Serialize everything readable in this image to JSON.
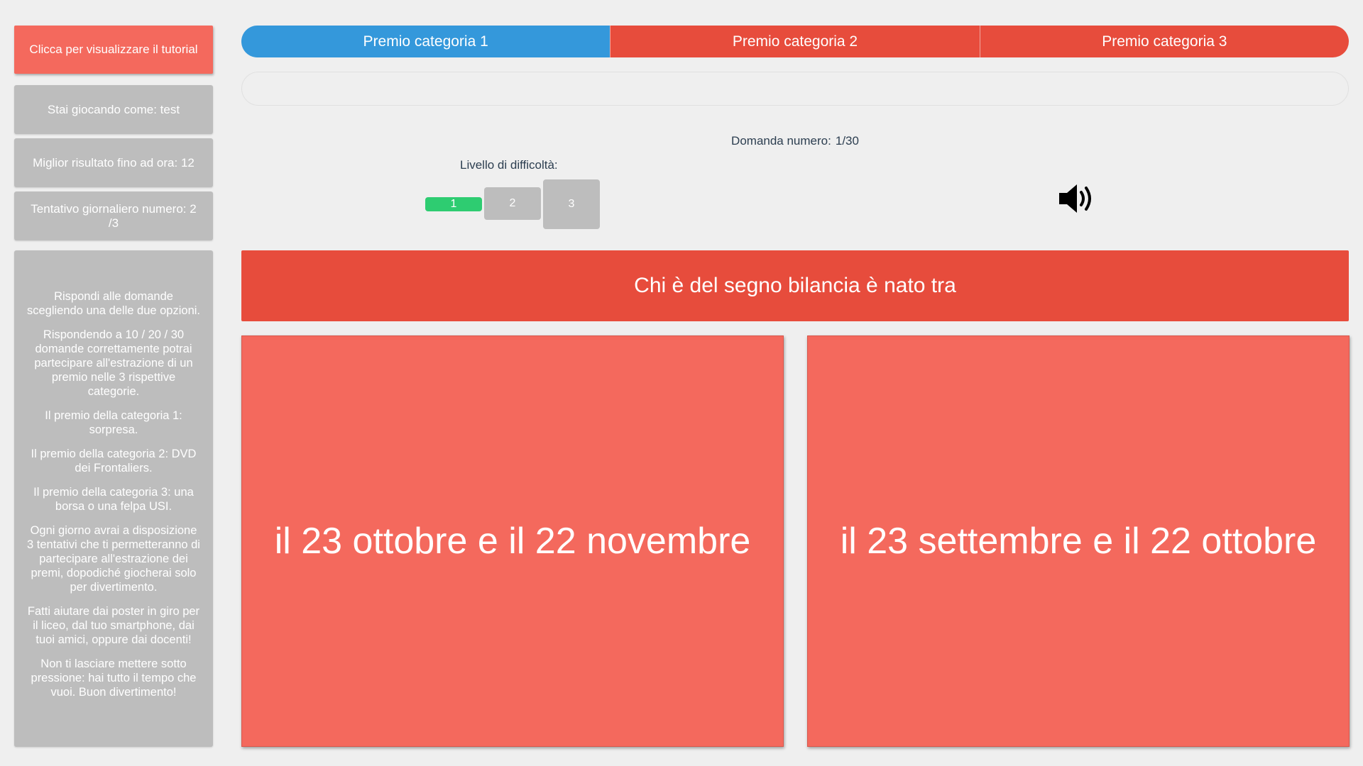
{
  "sidebar": {
    "tutorial_label": "Clicca per visualizzare il tutorial",
    "player_label": "Stai giocando come: test",
    "best_score_label": "Miglior risultato fino ad ora: 12",
    "attempt_label": "Tentativo giornaliero numero: 2 /3",
    "rules": [
      "Rispondi alle domande scegliendo una delle due opzioni.",
      "Rispondendo a 10 / 20 / 30 domande correttamente potrai partecipare all'estrazione di un premio nelle 3 rispettive categorie.",
      "Il premio della categoria 1: sorpresa.",
      "Il premio della categoria 2: DVD dei Frontaliers.",
      "Il premio della categoria 3: una borsa o una felpa USI.",
      "Ogni giorno avrai a disposizione 3 tentativi che ti permetteranno di partecipare all'estrazione dei premi, dopodiché giocherai solo per divertimento.",
      "Fatti aiutare dai poster in giro per il liceo, dal tuo smartphone, dai tuoi amici, oppure dai docenti!",
      "Non ti lasciare mettere sotto pressione: hai tutto il tempo che vuoi. Buon divertimento!"
    ]
  },
  "categories": [
    {
      "label": "Premio categoria 1",
      "active": true
    },
    {
      "label": "Premio categoria 2",
      "active": false
    },
    {
      "label": "Premio categoria 3",
      "active": false
    }
  ],
  "question_counter": {
    "label": "Domanda numero:",
    "value": "1/30"
  },
  "difficulty": {
    "label": "Livello di difficoltà:",
    "levels": [
      "1",
      "2",
      "3"
    ],
    "selected": "1"
  },
  "sound_icon": "speaker-volume-icon",
  "question": "Chi è del segno bilancia è nato tra",
  "answers": [
    "il 23 ottobre e il 22 novembre",
    "il 23 settembre e il 22 ottobre"
  ],
  "colors": {
    "active_tab": "#3498db",
    "inactive_tab": "#e74c3c",
    "answer_bg": "#f4695d",
    "panel_gray": "#bdbdbd",
    "level_selected": "#2ecc71"
  }
}
